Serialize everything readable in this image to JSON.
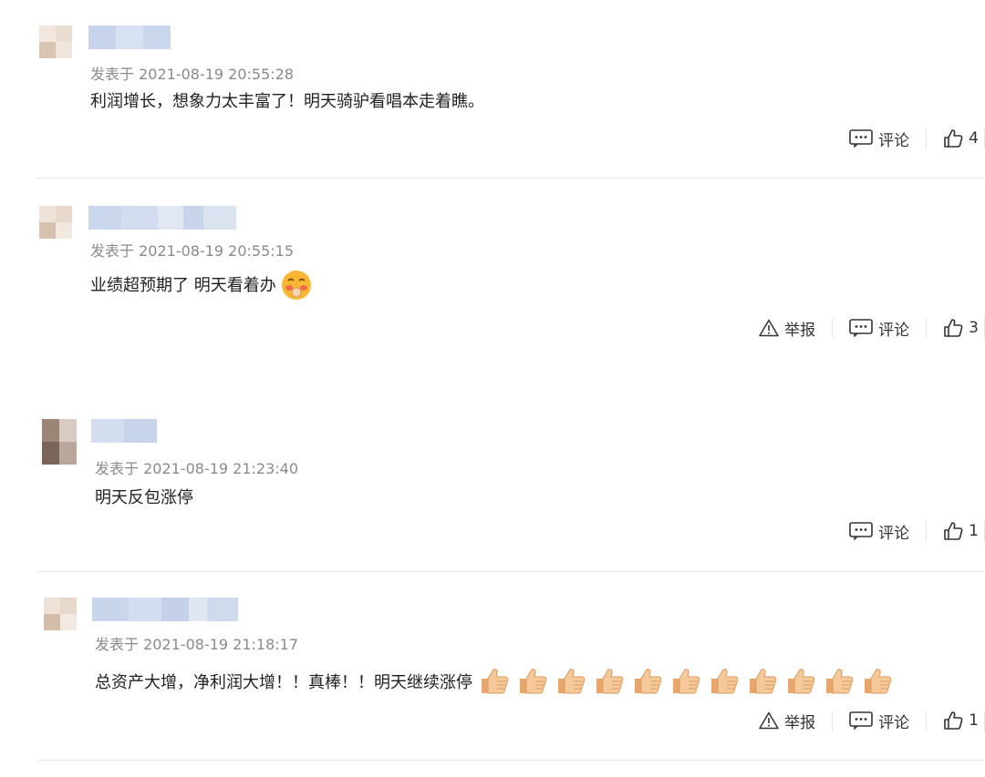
{
  "comments": [
    {
      "time": "发表于 2021-08-19 20:55:28",
      "text": "利润增长，想象力太丰富了！明天骑驴看唱本走着瞧。",
      "actions": {
        "comment_label": "评论",
        "likes": "4"
      },
      "has_report": false,
      "emoji": "none"
    },
    {
      "time": "发表于 2021-08-19 20:55:15",
      "text": "业绩超预期了 明天看着办",
      "actions": {
        "report_label": "举报",
        "comment_label": "评论",
        "likes": "3"
      },
      "has_report": true,
      "emoji": "blushing-face-icon"
    },
    {
      "time": "发表于 2021-08-19 21:23:40",
      "text": "明天反包涨停",
      "actions": {
        "comment_label": "评论",
        "likes": "1"
      },
      "has_report": false,
      "emoji": "none"
    },
    {
      "time": "发表于 2021-08-19 21:18:17",
      "text": "总资产大增，净利润大增！！真棒！！明天继续涨停",
      "actions": {
        "report_label": "举报",
        "comment_label": "评论",
        "likes": "1"
      },
      "has_report": true,
      "emoji": "thumbs-up-icon x11"
    }
  ],
  "colors": {
    "meta": "#8a8a8a",
    "divider": "#e8e8e8",
    "text": "#1f1f1f"
  }
}
